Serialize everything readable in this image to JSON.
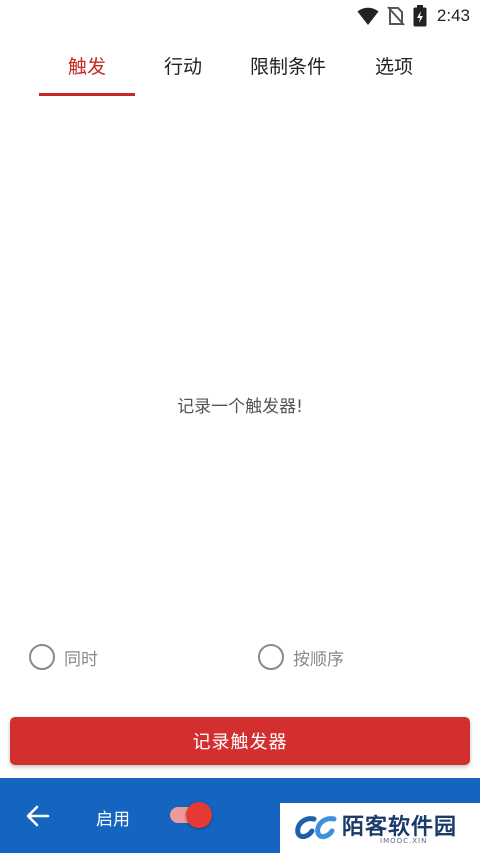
{
  "status_bar": {
    "time": "2:43",
    "icons": [
      "wifi-icon",
      "no-sim-icon",
      "battery-charging-icon"
    ]
  },
  "tabs": [
    {
      "label": "触发",
      "active": true
    },
    {
      "label": "行动",
      "active": false
    },
    {
      "label": "限制条件",
      "active": false
    },
    {
      "label": "选项",
      "active": false
    }
  ],
  "main": {
    "empty_message": "记录一个触发器!"
  },
  "trigger_mode": {
    "options": [
      "同时",
      "按顺序"
    ]
  },
  "record_button": {
    "label": "记录触发器"
  },
  "bottom_bar": {
    "back_icon": "arrow-left-icon",
    "enable_label": "启用",
    "enabled": true
  },
  "watermark": {
    "title": "陌客软件园",
    "subtitle": "IMOOC.XIN"
  },
  "colors": {
    "accent": "#c62828",
    "button": "#d32f2f",
    "bottom_bar": "#1565c0",
    "toggle_thumb": "#e53935",
    "toggle_track": "#ef9a9a"
  }
}
